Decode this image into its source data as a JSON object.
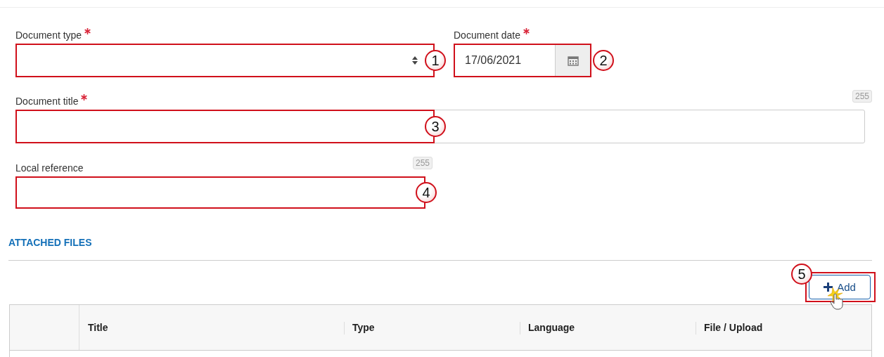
{
  "fields": [
    {
      "kind": "select",
      "label": "Document type",
      "required": true,
      "highlighted": true,
      "callout": "1"
    },
    {
      "kind": "date",
      "label": "Document date",
      "required": true,
      "value": "17/06/2021",
      "highlighted": true,
      "callout": "2"
    },
    {
      "kind": "text",
      "label": "Document title",
      "required": true,
      "counter": "255",
      "highlighted": true,
      "callout": "3"
    },
    {
      "kind": "text",
      "label": "Local reference",
      "required": false,
      "counter": "255",
      "highlighted": true,
      "callout": "4"
    }
  ],
  "section": {
    "title": "ATTACHED FILES"
  },
  "add_button": {
    "label": "Add",
    "callout": "5"
  },
  "table": {
    "columns": [
      "Title",
      "Type",
      "Language",
      "File / Upload"
    ]
  }
}
